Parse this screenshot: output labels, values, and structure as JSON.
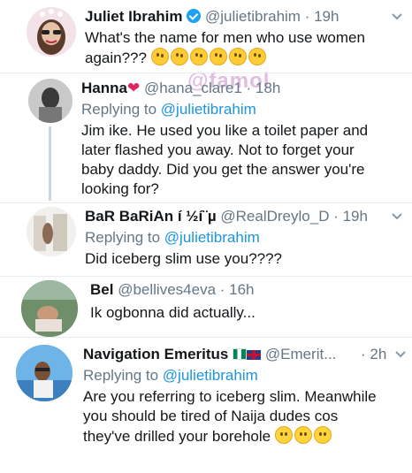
{
  "watermark": "@famol",
  "tweets": [
    {
      "name": "Juliet Ibrahim",
      "handle": "@julietibrahim",
      "time": "· 19h",
      "text": [
        "What's the name for men who use women",
        "again???"
      ],
      "emoji": "thinking-face"
    },
    {
      "name": "Hanna",
      "name_emoji": "❤",
      "handle": "@hana_clare1",
      "time": "· 18h",
      "reply_prefix": "Replying to",
      "reply_to": "@julietibrahim",
      "text": [
        "Jim ike. He used you like a toilet paper and",
        "later flashed you away. Not to forget your",
        "baby daddy. Did you get the answer you're",
        "looking for?"
      ]
    },
    {
      "name": "BaR BaRiAn í ½í¨µ",
      "handle": "@RealDreylo_D",
      "time": "· 19h",
      "reply_prefix": "Replying to",
      "reply_to": "@julietibrahim",
      "text": [
        "Did iceberg slim use you????"
      ]
    },
    {
      "name": "Bel",
      "handle": "@bellives4eva",
      "time": "· 16h",
      "text": [
        "Ik ogbonna did actually..."
      ]
    },
    {
      "name": "Navigation Emeritus",
      "handle": "@Emerit...",
      "time": "· 2h",
      "reply_prefix": "Replying to",
      "reply_to": "@julietibrahim",
      "text": [
        "Are you referring to iceberg slim. Meanwhile",
        "you should be tired of Naija dudes cos",
        "they've drilled your borehole"
      ],
      "emoji": "grinning-face"
    }
  ]
}
